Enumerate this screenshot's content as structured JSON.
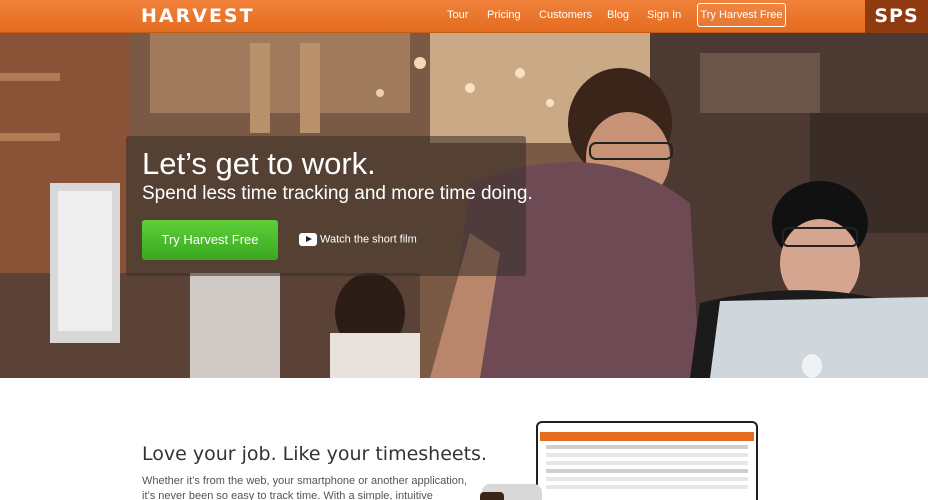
{
  "brand": {
    "logo": "HARVEST",
    "badge": "SPS",
    "accent": "#e87a2e",
    "cta_green": "#45b427"
  },
  "nav": {
    "links": [
      "Tour",
      "Pricing",
      "Customers",
      "Blog",
      "Sign In"
    ],
    "cta": "Try Harvest Free"
  },
  "hero": {
    "title": "Let’s get to work.",
    "subtitle": "Spend less time tracking and more time doing.",
    "cta": "Try Harvest Free",
    "film_link": "Watch the short film",
    "film_icon": "youtube-play-icon"
  },
  "section": {
    "title": "Love your job. Like your timesheets.",
    "body_lines": [
      "Whether it’s from the web, your smartphone or another application,",
      "it’s never been so easy to track time. With a simple, intuitive"
    ]
  }
}
